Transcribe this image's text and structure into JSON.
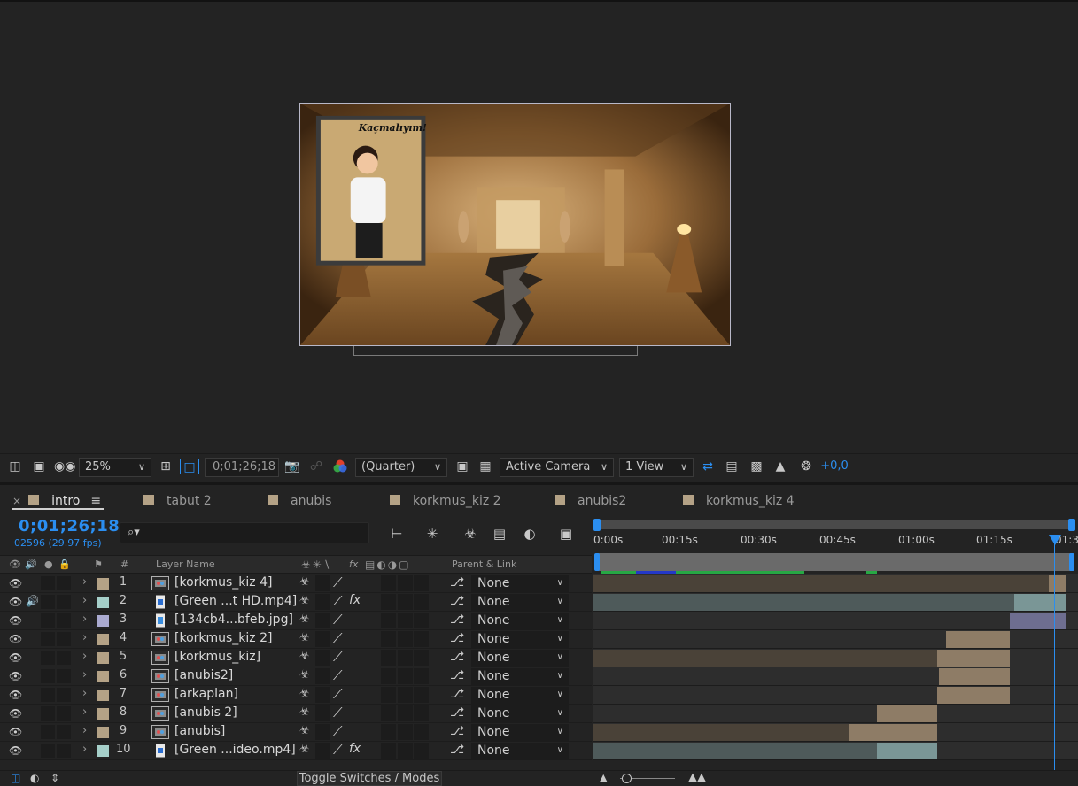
{
  "viewer": {
    "comp_text": "Kaçmalıyım!"
  },
  "viewer_toolbar": {
    "zoom": "25%",
    "timecode": "0;01;26;18",
    "resolution": "(Quarter)",
    "camera": "Active Camera",
    "views": "1 View",
    "exposure": "+0,0"
  },
  "tabs": [
    {
      "label": "intro",
      "active": true
    },
    {
      "label": "tabut 2"
    },
    {
      "label": "anubis"
    },
    {
      "label": "korkmus_kiz 2"
    },
    {
      "label": "anubis2"
    },
    {
      "label": "korkmus_kiz 4"
    }
  ],
  "timeline": {
    "timecode": "0;01;26;18",
    "frames": "02596 (29.97 fps)",
    "search_placeholder": "⌕▾",
    "columns": {
      "num": "#",
      "layer_name": "Layer Name",
      "parent": "Parent & Link"
    },
    "ruler": [
      "0:00s",
      "00:15s",
      "00:30s",
      "00:45s",
      "01:00s",
      "01:15s",
      "01:3"
    ],
    "layers": [
      {
        "num": "1",
        "name": "[korkmus_kiz 4]",
        "parent": "None",
        "label_color": "#b4a286",
        "type": "comp",
        "fx": false,
        "audio": false
      },
      {
        "num": "2",
        "name": "[Green ...t HD.mp4]",
        "parent": "None",
        "label_color": "#a5cfc9",
        "type": "video",
        "fx": true,
        "audio": true
      },
      {
        "num": "3",
        "name": "[134cb4...bfeb.jpg]",
        "parent": "None",
        "label_color": "#aaaad0",
        "type": "image",
        "fx": false,
        "audio": false
      },
      {
        "num": "4",
        "name": "[korkmus_kiz 2]",
        "parent": "None",
        "label_color": "#b4a286",
        "type": "comp",
        "fx": false,
        "audio": false
      },
      {
        "num": "5",
        "name": "[korkmus_kiz]",
        "parent": "None",
        "label_color": "#b4a286",
        "type": "comp",
        "fx": false,
        "audio": false
      },
      {
        "num": "6",
        "name": "[anubis2]",
        "parent": "None",
        "label_color": "#b4a286",
        "type": "comp",
        "fx": false,
        "audio": false
      },
      {
        "num": "7",
        "name": "[arkaplan]",
        "parent": "None",
        "label_color": "#b4a286",
        "type": "comp",
        "fx": false,
        "audio": false
      },
      {
        "num": "8",
        "name": "[anubis 2]",
        "parent": "None",
        "label_color": "#b4a286",
        "type": "comp",
        "fx": false,
        "audio": false
      },
      {
        "num": "9",
        "name": "[anubis]",
        "parent": "None",
        "label_color": "#b4a286",
        "type": "comp",
        "fx": false,
        "audio": false
      },
      {
        "num": "10",
        "name": "[Green ...ideo.mp4]",
        "parent": "None",
        "label_color": "#a5cfc9",
        "type": "video",
        "fx": true,
        "audio": false
      }
    ]
  },
  "bottom": {
    "toggle_label": "Toggle Switches / Modes"
  },
  "colors": {
    "accent": "#2b8ef0",
    "comp_label": "#b4a286",
    "video_label": "#a5cfc9",
    "image_label": "#aaaad0"
  }
}
